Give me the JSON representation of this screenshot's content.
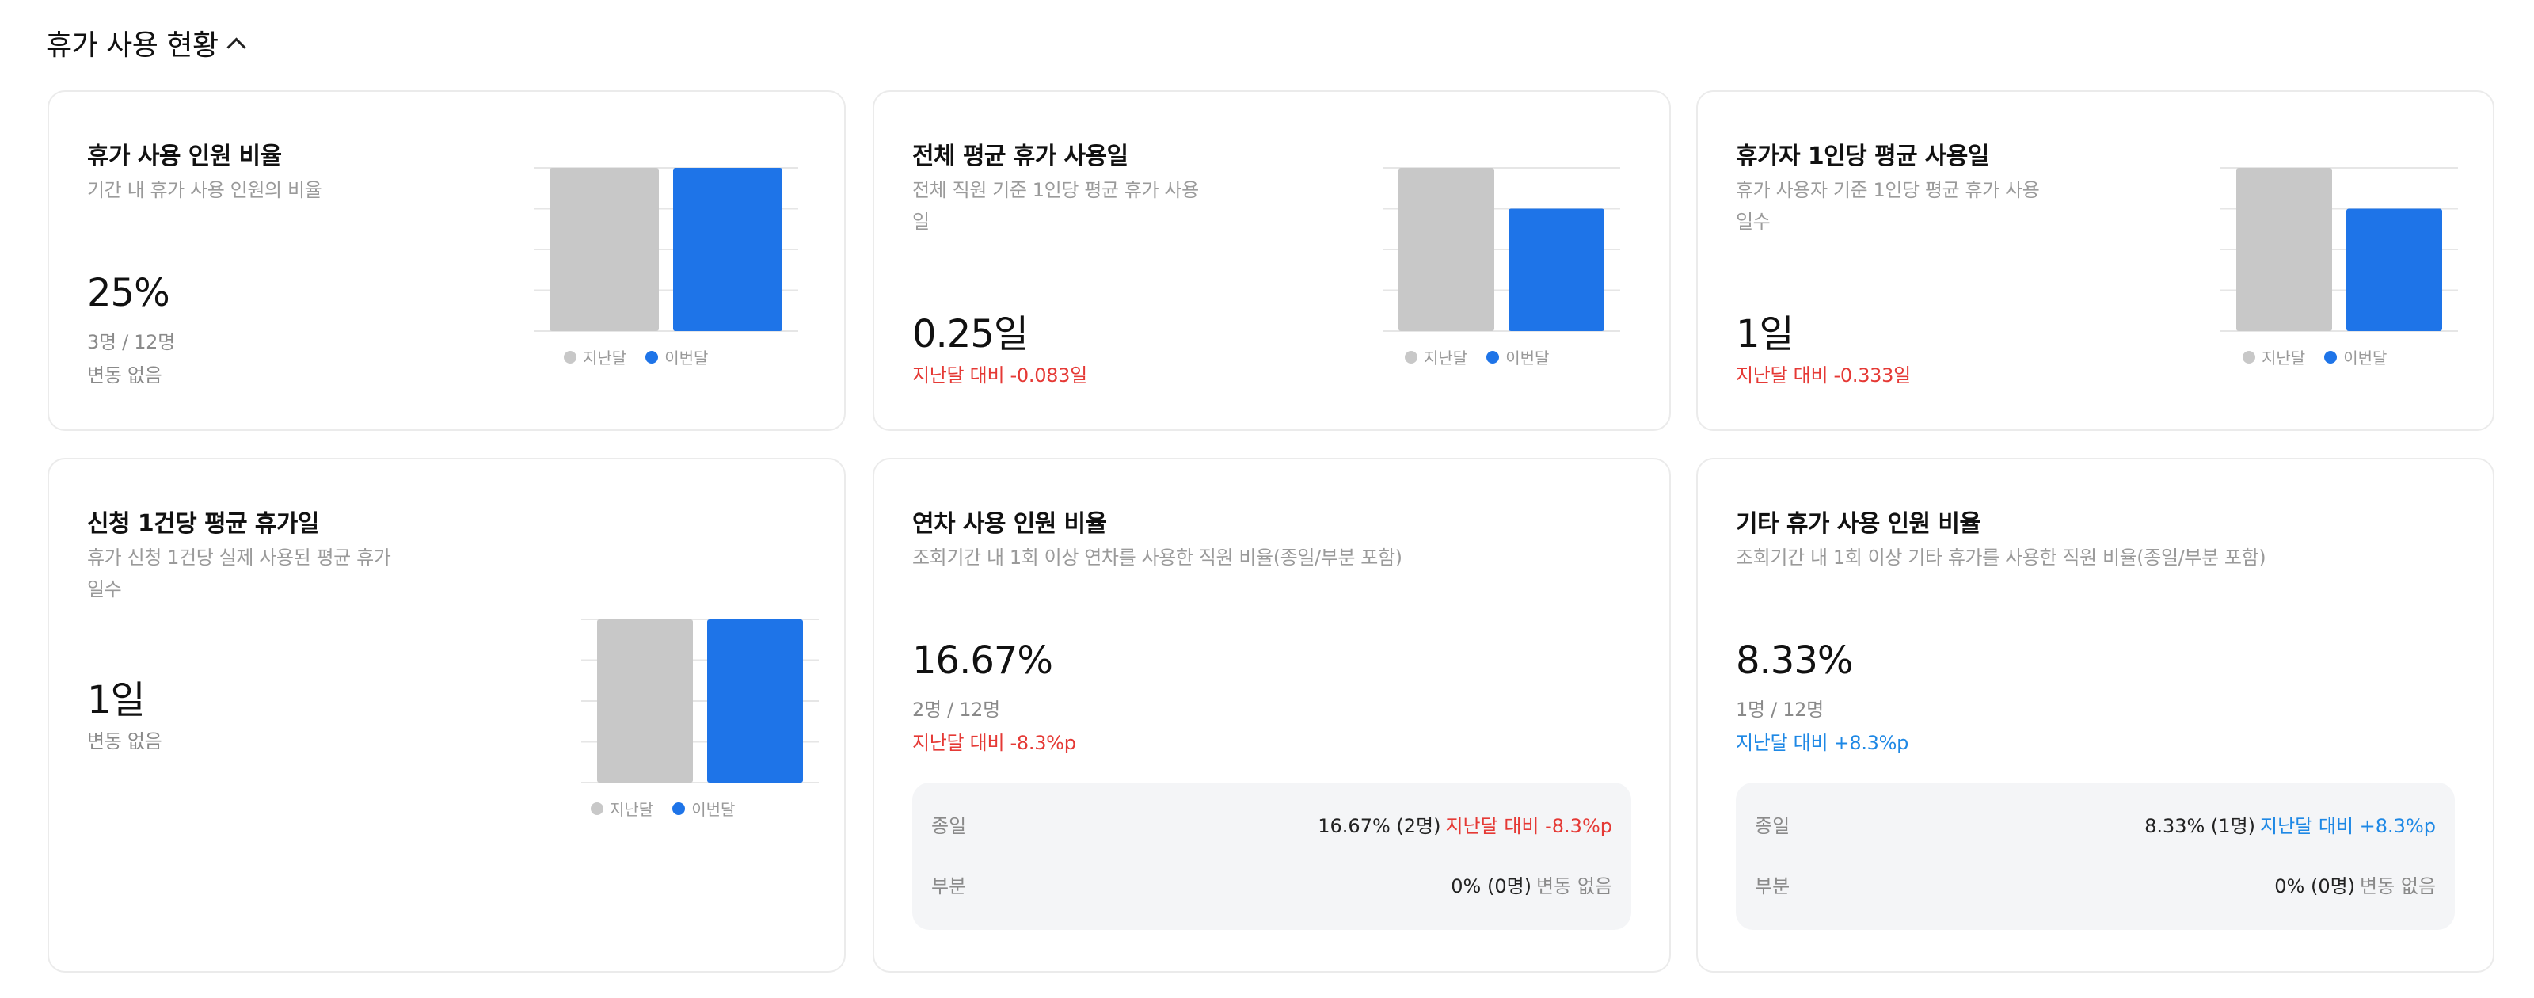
{
  "section": {
    "title": "휴가 사용 현황"
  },
  "legend": {
    "prev": "지난달",
    "curr": "이번달"
  },
  "colors": {
    "prev": "#c8c8c8",
    "curr": "#1e74e8",
    "negative": "#e53935",
    "positive": "#1e88e5"
  },
  "cards": {
    "c1": {
      "title": "휴가 사용 인원 비율",
      "desc": "기간 내 휴가 사용 인원의 비율",
      "value": "25%",
      "sub1": "3명 / 12명",
      "sub2": "변동 없음"
    },
    "c2": {
      "title": "전체 평균 휴가 사용일",
      "desc_l1": "전체 직원 기준 1인당 평균 휴가 사용",
      "desc_l2": "일",
      "value": "0.25일",
      "change": "지난달 대비 -0.083일"
    },
    "c3": {
      "title": "휴가자 1인당 평균 사용일",
      "desc_l1": "휴가 사용자 기준 1인당 평균 휴가 사용",
      "desc_l2": "일수",
      "value": "1일",
      "change": "지난달 대비 -0.333일"
    },
    "c4": {
      "title": "신청 1건당 평균 휴가일",
      "desc_l1": "휴가 신청 1건당 실제 사용된 평균 휴가",
      "desc_l2": "일수",
      "value": "1일",
      "sub1": "변동 없음"
    },
    "c5": {
      "title": "연차 사용 인원 비율",
      "desc": "조회기간 내 1회 이상 연차를 사용한 직원 비율(종일/부분 포함)",
      "value": "16.67%",
      "sub1": "2명 / 12명",
      "change": "지난달 대비 -8.3%p",
      "rows": [
        {
          "label": "종일",
          "value": "16.67% (2명)",
          "note": "지난달 대비 -8.3%p"
        },
        {
          "label": "부분",
          "value": "0% (0명)",
          "note": "변동 없음"
        }
      ]
    },
    "c6": {
      "title": "기타 휴가 사용 인원 비율",
      "desc": "조회기간 내 1회 이상 기타 휴가를 사용한 직원 비율(종일/부분 포함)",
      "value": "8.33%",
      "sub1": "1명 / 12명",
      "change": "지난달 대비 +8.3%p",
      "rows": [
        {
          "label": "종일",
          "value": "8.33% (1명)",
          "note": "지난달 대비 +8.3%p"
        },
        {
          "label": "부분",
          "value": "0% (0명)",
          "note": "변동 없음"
        }
      ]
    }
  },
  "chart_data": [
    {
      "type": "bar",
      "card": "c1",
      "categories": [
        "지난달",
        "이번달"
      ],
      "values": [
        1,
        1
      ]
    },
    {
      "type": "bar",
      "card": "c2",
      "categories": [
        "지난달",
        "이번달"
      ],
      "values": [
        1,
        0.75
      ]
    },
    {
      "type": "bar",
      "card": "c3",
      "categories": [
        "지난달",
        "이번달"
      ],
      "values": [
        1,
        0.75
      ]
    },
    {
      "type": "bar",
      "card": "c4",
      "categories": [
        "지난달",
        "이번달"
      ],
      "values": [
        1,
        1
      ]
    }
  ]
}
